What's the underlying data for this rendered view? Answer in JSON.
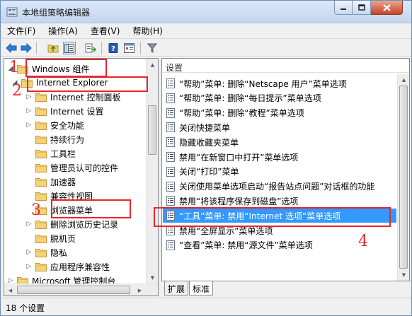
{
  "window": {
    "title": "本地组策略编辑器"
  },
  "menubar": [
    {
      "name": "menu-file",
      "label": "文件(F)"
    },
    {
      "name": "menu-action",
      "label": "操作(A)"
    },
    {
      "name": "menu-view",
      "label": "查看(V)"
    },
    {
      "name": "menu-help",
      "label": "帮助(H)"
    }
  ],
  "toolbar": {
    "icons": [
      "back-arrow-icon",
      "forward-arrow-icon",
      "up-folder-icon",
      "show-hide-tree-icon",
      "export-list-icon",
      "help-icon",
      "properties-icon",
      "filter-icon"
    ]
  },
  "tree": {
    "items": [
      {
        "label": "Windows 组件",
        "expanded": true
      },
      {
        "label": "Internet Explorer",
        "expanded": true
      },
      {
        "label": "Internet 控制面板"
      },
      {
        "label": "Internet 设置"
      },
      {
        "label": "安全功能"
      },
      {
        "label": "持续行为"
      },
      {
        "label": "工具栏"
      },
      {
        "label": "管理员认可的控件"
      },
      {
        "label": "加速器"
      },
      {
        "label": "兼容性视图"
      },
      {
        "label": "浏览器菜单",
        "selected": true
      },
      {
        "label": "删除浏览历史记录"
      },
      {
        "label": "脱机页"
      },
      {
        "label": "隐私"
      },
      {
        "label": "应用程序兼容性"
      },
      {
        "label": "Microsoft 管理控制台"
      }
    ]
  },
  "list": {
    "header": "设置",
    "rows": [
      "“帮助”菜单: 删除“Netscape 用户”菜单选项",
      "“帮助”菜单: 删除“每日提示”菜单选项",
      "“帮助”菜单: 删除“教程”菜单选项",
      "关闭快捷菜单",
      "隐藏收藏夹菜单",
      "禁用“在新窗口中打开”菜单选项",
      "关闭“打印”菜单",
      "关闭使用菜单选项启动“报告站点问题”对话框的功能",
      "禁用“将该程序保存到磁盘”选项",
      "“工具”菜单: 禁用“Internet 选项”菜单选项",
      "禁用“全屏显示”菜单选项",
      "“查看”菜单: 禁用“源文件”菜单选项"
    ],
    "selected_index": 9
  },
  "tabs": {
    "extended": "扩展",
    "standard": "标准"
  },
  "status": {
    "text": "18 个设置"
  },
  "annotations": {
    "n1": "1",
    "n2": "2",
    "n3": "3",
    "n4": "4"
  },
  "colors": {
    "selection": "#3399ff",
    "annotation": "#e8262c"
  }
}
